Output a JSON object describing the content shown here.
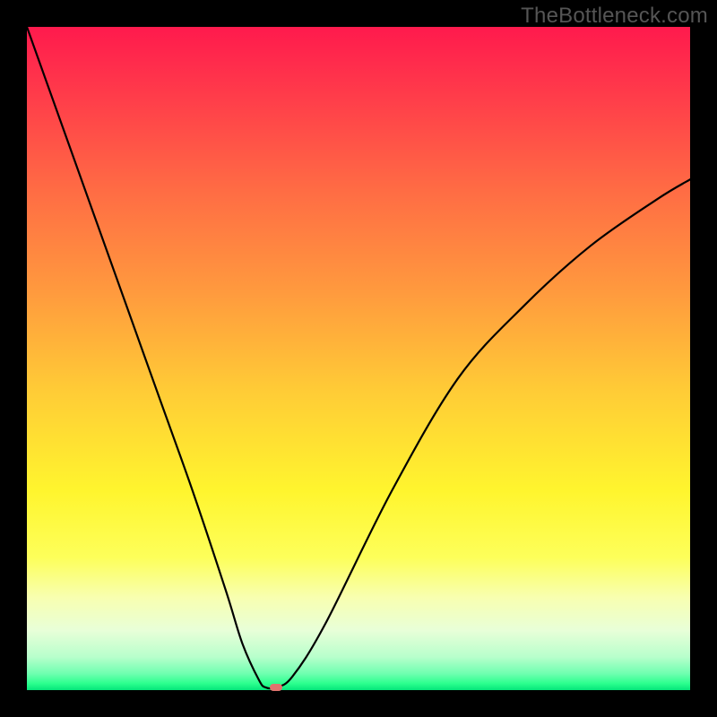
{
  "watermark": "TheBottleneck.com",
  "chart_data": {
    "type": "line",
    "title": "",
    "xlabel": "",
    "ylabel": "",
    "xlim": [
      0,
      1
    ],
    "ylim": [
      0,
      1
    ],
    "grid": false,
    "legend": false,
    "background_gradient": {
      "top_color": "#ff1a4d",
      "bottom_color": "#05e57a",
      "description": "vertical gradient red→orange→yellow→green"
    },
    "series": [
      {
        "name": "bottleneck-curve",
        "color": "#000000",
        "x": [
          0.0,
          0.05,
          0.1,
          0.15,
          0.2,
          0.25,
          0.3,
          0.325,
          0.35,
          0.36,
          0.375,
          0.4,
          0.45,
          0.55,
          0.65,
          0.75,
          0.85,
          0.95,
          1.0
        ],
        "y": [
          1.0,
          0.86,
          0.72,
          0.58,
          0.44,
          0.3,
          0.15,
          0.07,
          0.015,
          0.004,
          0.004,
          0.02,
          0.1,
          0.3,
          0.47,
          0.58,
          0.67,
          0.74,
          0.77
        ]
      }
    ],
    "markers": [
      {
        "name": "optimal-point",
        "x": 0.375,
        "y": 0.004,
        "color": "#e0736e"
      }
    ]
  }
}
